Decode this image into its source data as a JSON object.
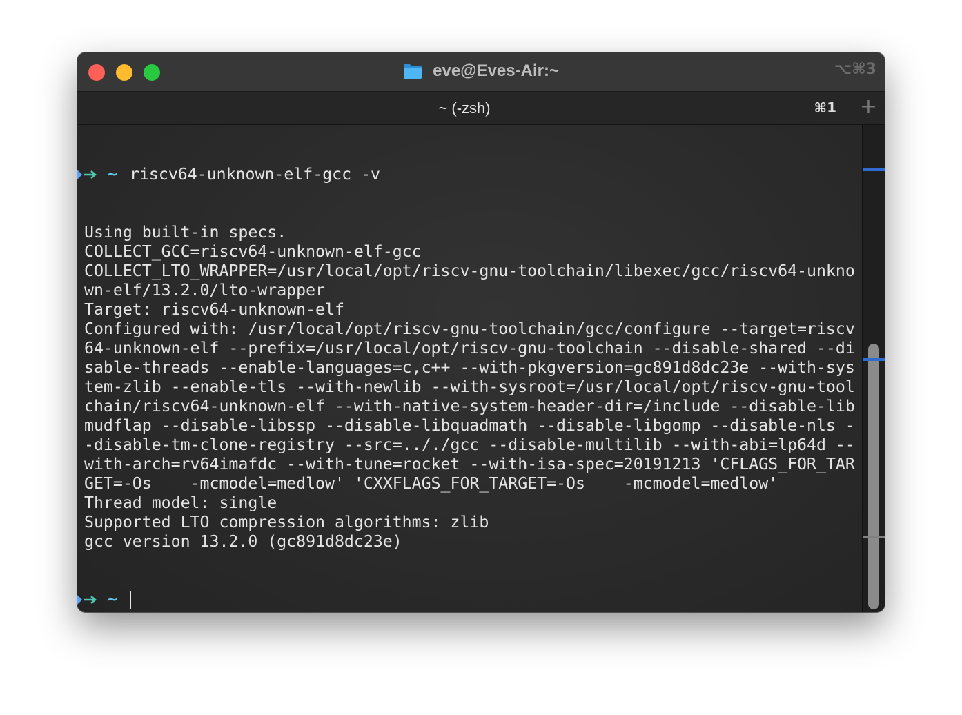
{
  "window": {
    "title": "eve@Eves-Air:~",
    "window_shortcut": "⌥⌘3",
    "folder_icon_color": "#3ba6e8"
  },
  "tab": {
    "label": "~ (-zsh)",
    "shortcut": "⌘1",
    "new_tab_icon": "+"
  },
  "prompt": {
    "arrow_color": "#4ec9b0",
    "tilde": "~",
    "tilde_color": "#5ec3e6"
  },
  "terminal": {
    "command": "riscv64-unknown-elf-gcc -v",
    "output_lines": [
      "Using built-in specs.",
      "COLLECT_GCC=riscv64-unknown-elf-gcc",
      "COLLECT_LTO_WRAPPER=/usr/local/opt/riscv-gnu-toolchain/libexec/gcc/riscv64-unkno",
      "wn-elf/13.2.0/lto-wrapper",
      "Target: riscv64-unknown-elf",
      "Configured with: /usr/local/opt/riscv-gnu-toolchain/gcc/configure --target=riscv",
      "64-unknown-elf --prefix=/usr/local/opt/riscv-gnu-toolchain --disable-shared --di",
      "sable-threads --enable-languages=c,c++ --with-pkgversion=gc891d8dc23e --with-sys",
      "tem-zlib --enable-tls --with-newlib --with-sysroot=/usr/local/opt/riscv-gnu-tool",
      "chain/riscv64-unknown-elf --with-native-system-header-dir=/include --disable-lib",
      "mudflap --disable-libssp --disable-libquadmath --disable-libgomp --disable-nls -",
      "-disable-tm-clone-registry --src=.././gcc --disable-multilib --with-abi=lp64d --",
      "with-arch=rv64imafdc --with-tune=rocket --with-isa-spec=20191213 'CFLAGS_FOR_TAR",
      "GET=-Os    -mcmodel=medlow' 'CXXFLAGS_FOR_TARGET=-Os    -mcmodel=medlow'",
      "Thread model: single",
      "Supported LTO compression algorithms: zlib",
      "gcc version 13.2.0 (gc891d8dc23e)"
    ]
  },
  "scrollbar": {
    "mark_color": "#2f6bd0"
  }
}
